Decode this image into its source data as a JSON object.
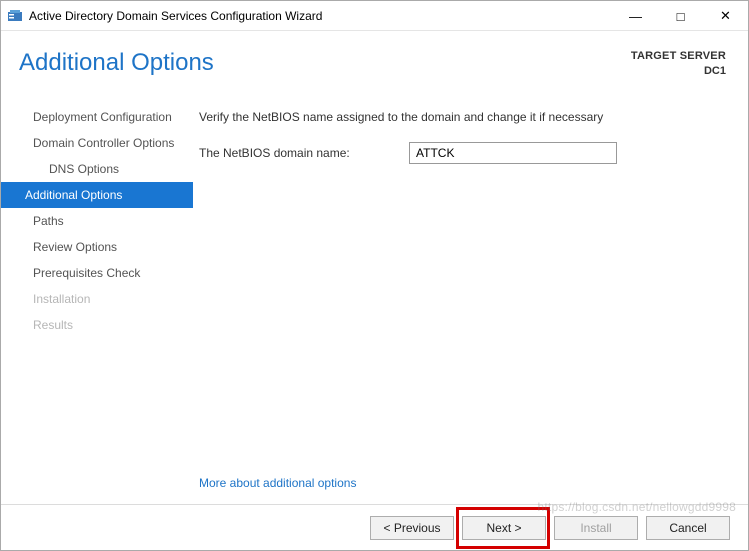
{
  "window": {
    "title": "Active Directory Domain Services Configuration Wizard"
  },
  "header": {
    "page_title": "Additional Options",
    "target_label": "TARGET SERVER",
    "target_host": "DC1"
  },
  "sidebar": {
    "items": [
      {
        "label": "Deployment Configuration",
        "indent": false,
        "active": false,
        "disabled": false
      },
      {
        "label": "Domain Controller Options",
        "indent": false,
        "active": false,
        "disabled": false
      },
      {
        "label": "DNS Options",
        "indent": true,
        "active": false,
        "disabled": false
      },
      {
        "label": "Additional Options",
        "indent": false,
        "active": true,
        "disabled": false
      },
      {
        "label": "Paths",
        "indent": false,
        "active": false,
        "disabled": false
      },
      {
        "label": "Review Options",
        "indent": false,
        "active": false,
        "disabled": false
      },
      {
        "label": "Prerequisites Check",
        "indent": false,
        "active": false,
        "disabled": false
      },
      {
        "label": "Installation",
        "indent": false,
        "active": false,
        "disabled": true
      },
      {
        "label": "Results",
        "indent": false,
        "active": false,
        "disabled": true
      }
    ]
  },
  "content": {
    "instruction": "Verify the NetBIOS name assigned to the domain and change it if necessary",
    "netbios_label": "The NetBIOS domain name:",
    "netbios_value": "ATTCK",
    "more_link": "More about additional options"
  },
  "footer": {
    "previous": "< Previous",
    "next": "Next >",
    "install": "Install",
    "cancel": "Cancel"
  },
  "watermark": "https://blog.csdn.net/nellowgdd9998"
}
